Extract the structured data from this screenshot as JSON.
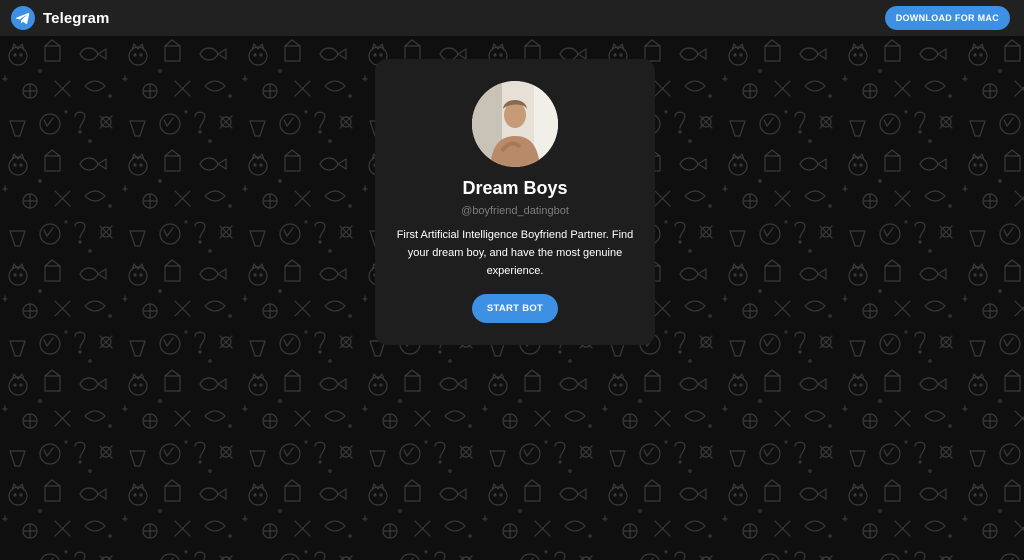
{
  "header": {
    "brand_name": "Telegram",
    "brand_icon": "telegram-logo-icon",
    "download_label": "DOWNLOAD FOR MAC"
  },
  "bot": {
    "name": "Dream Boys",
    "username": "@boyfriend_datingbot",
    "description": "First Artificial Intelligence Boyfriend Partner. Find your dream boy, and have the most genuine experience.",
    "start_label": "START BOT",
    "avatar": "profile-photo"
  },
  "colors": {
    "accent": "#3e90e4",
    "header_bg": "#212121",
    "page_bg": "#0f0f0f",
    "card_bg": "#1e1e1e",
    "muted_text": "#7d7d7d"
  }
}
